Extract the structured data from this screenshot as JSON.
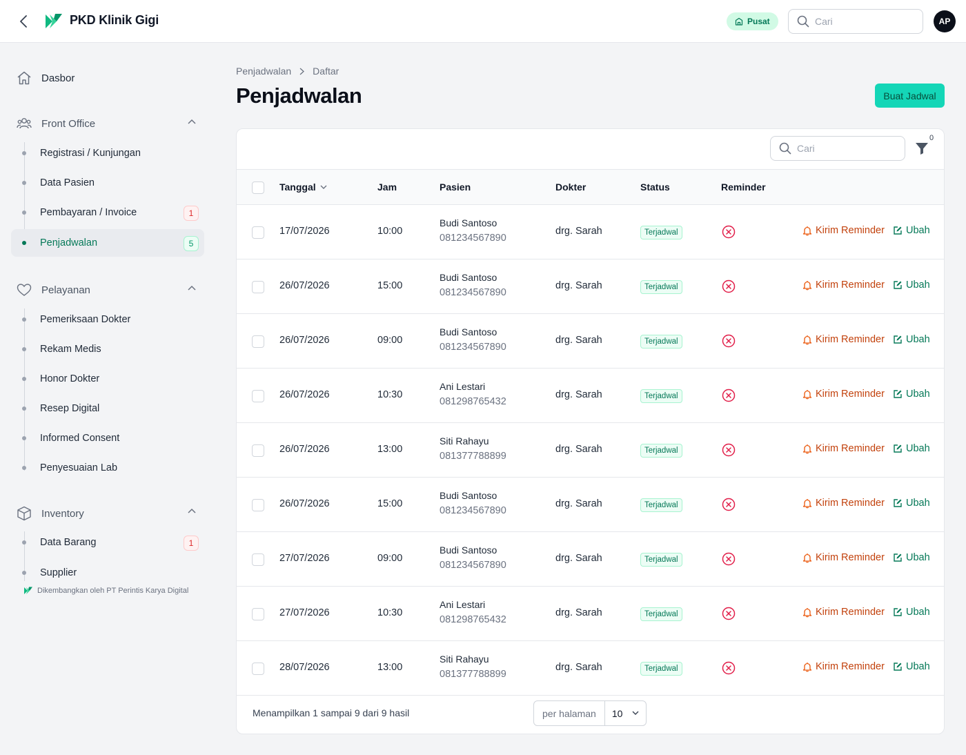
{
  "header": {
    "app_title": "PKD Klinik Gigi",
    "branch": "Pusat",
    "search_placeholder": "Cari",
    "avatar_initials": "AP"
  },
  "sidebar": {
    "dashboard": "Dasbor",
    "groups": [
      {
        "label": "Front Office",
        "icon": "users-icon",
        "items": [
          {
            "label": "Registrasi / Kunjungan"
          },
          {
            "label": "Data Pasien"
          },
          {
            "label": "Pembayaran / Invoice",
            "badge": "1"
          },
          {
            "label": "Penjadwalan",
            "badge": "5",
            "active": true
          }
        ]
      },
      {
        "label": "Pelayanan",
        "icon": "heart-icon",
        "items": [
          {
            "label": "Pemeriksaan Dokter"
          },
          {
            "label": "Rekam Medis"
          },
          {
            "label": "Honor Dokter"
          },
          {
            "label": "Resep Digital"
          },
          {
            "label": "Informed Consent"
          },
          {
            "label": "Penyesuaian Lab"
          }
        ]
      },
      {
        "label": "Inventory",
        "icon": "box-icon",
        "items": [
          {
            "label": "Data Barang",
            "badge": "1"
          },
          {
            "label": "Supplier"
          }
        ]
      }
    ],
    "footer_credit": "Dikembangkan oleh PT Perintis Karya Digital"
  },
  "breadcrumb": {
    "parent": "Penjadwalan",
    "current": "Daftar"
  },
  "page_title": "Penjadwalan",
  "create_button": "Buat Jadwal",
  "table": {
    "search_placeholder": "Cari",
    "filter_count": "0",
    "columns": {
      "date": "Tanggal",
      "time": "Jam",
      "patient": "Pasien",
      "doctor": "Dokter",
      "status": "Status",
      "reminder": "Reminder"
    },
    "action_reminder": "Kirim Reminder",
    "action_edit": "Ubah",
    "rows": [
      {
        "date": "17/07/2026",
        "time": "10:00",
        "patient": "Budi Santoso",
        "phone": "081234567890",
        "doctor": "drg. Sarah",
        "status": "Terjadwal"
      },
      {
        "date": "26/07/2026",
        "time": "15:00",
        "patient": "Budi Santoso",
        "phone": "081234567890",
        "doctor": "drg. Sarah",
        "status": "Terjadwal"
      },
      {
        "date": "26/07/2026",
        "time": "09:00",
        "patient": "Budi Santoso",
        "phone": "081234567890",
        "doctor": "drg. Sarah",
        "status": "Terjadwal"
      },
      {
        "date": "26/07/2026",
        "time": "10:30",
        "patient": "Ani Lestari",
        "phone": "081298765432",
        "doctor": "drg. Sarah",
        "status": "Terjadwal"
      },
      {
        "date": "26/07/2026",
        "time": "13:00",
        "patient": "Siti Rahayu",
        "phone": "081377788899",
        "doctor": "drg. Sarah",
        "status": "Terjadwal"
      },
      {
        "date": "26/07/2026",
        "time": "15:00",
        "patient": "Budi Santoso",
        "phone": "081234567890",
        "doctor": "drg. Sarah",
        "status": "Terjadwal"
      },
      {
        "date": "27/07/2026",
        "time": "09:00",
        "patient": "Budi Santoso",
        "phone": "081234567890",
        "doctor": "drg. Sarah",
        "status": "Terjadwal"
      },
      {
        "date": "27/07/2026",
        "time": "10:30",
        "patient": "Ani Lestari",
        "phone": "081298765432",
        "doctor": "drg. Sarah",
        "status": "Terjadwal"
      },
      {
        "date": "28/07/2026",
        "time": "13:00",
        "patient": "Siti Rahayu",
        "phone": "081377788899",
        "doctor": "drg. Sarah",
        "status": "Terjadwal"
      }
    ],
    "pagination": {
      "summary": "Menampilkan 1 sampai 9 dari 9 hasil",
      "per_page_label": "per halaman",
      "per_page_value": "10"
    }
  },
  "colors": {
    "accent": "#14d6b7",
    "brand_green": "#047857",
    "reminder_orange": "#c2410c",
    "error_red": "#e11d48"
  }
}
